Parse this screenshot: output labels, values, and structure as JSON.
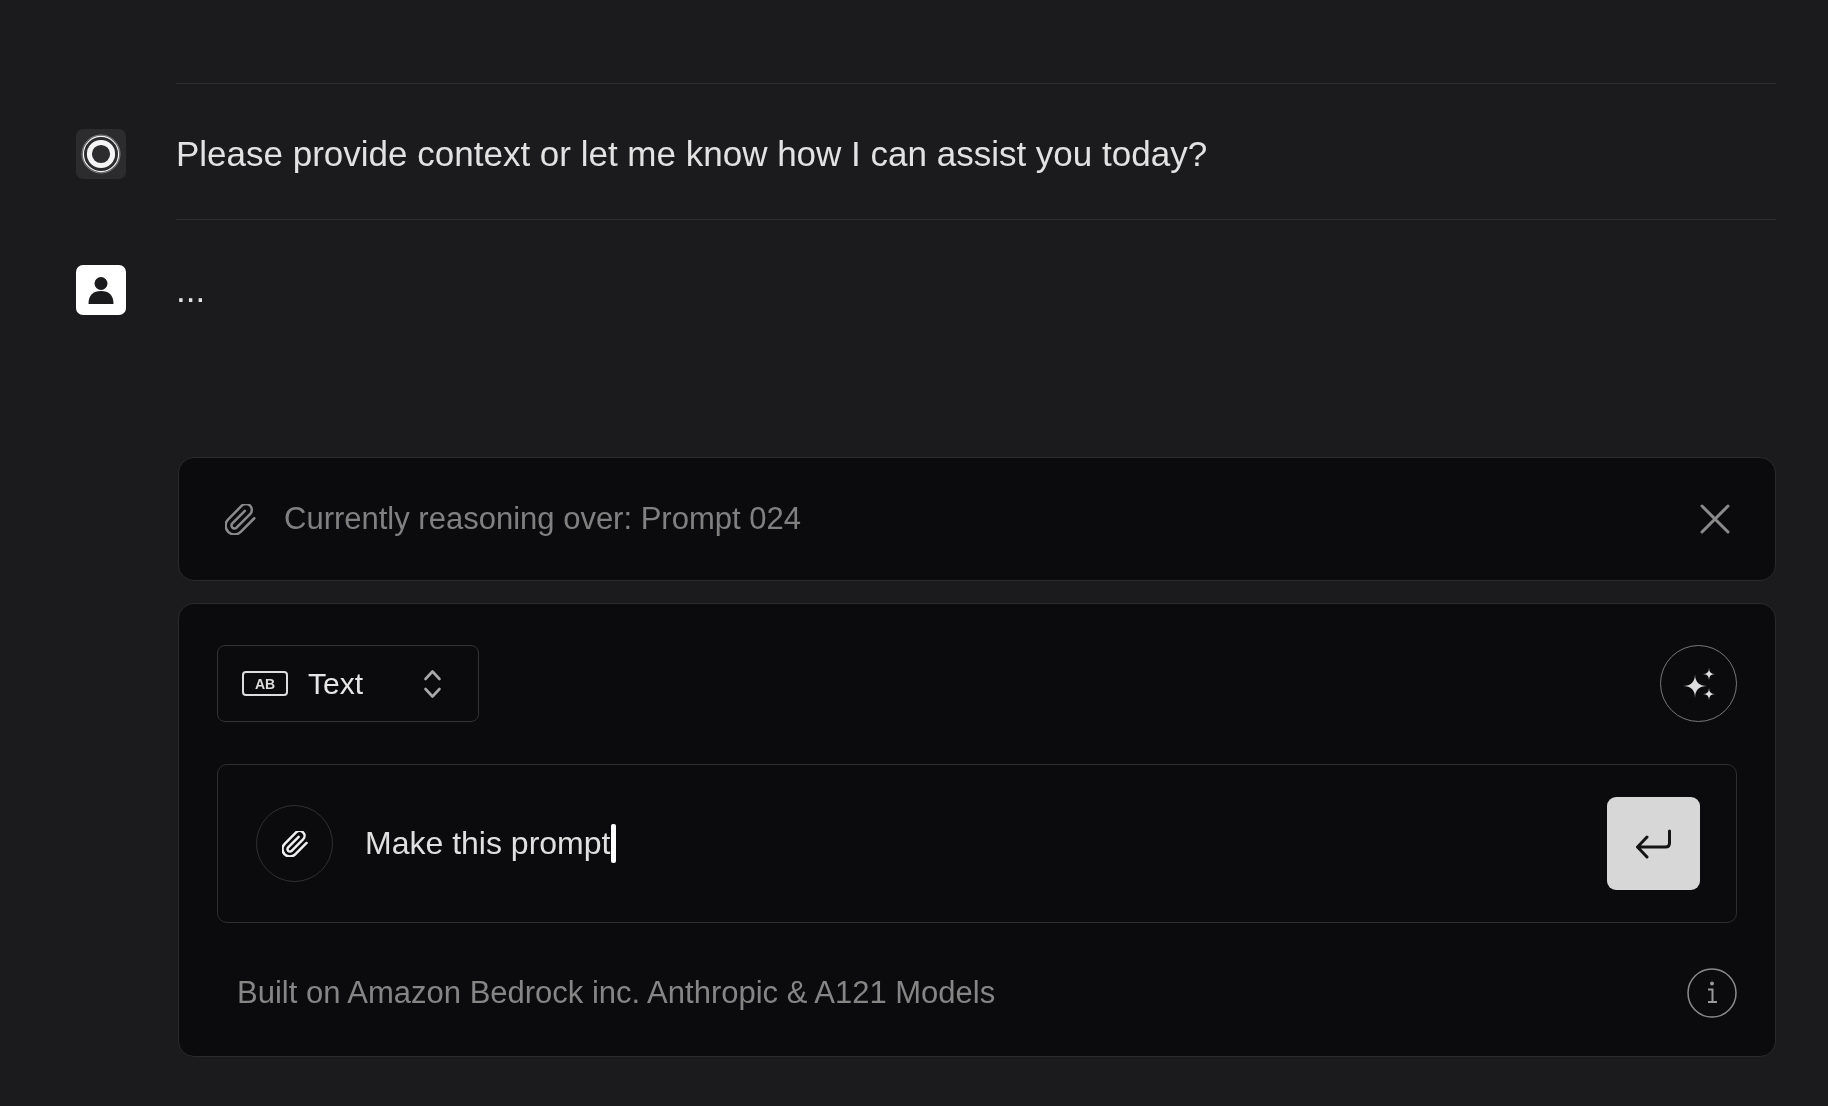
{
  "messages": [
    {
      "kind": "bot",
      "text": "Please provide context or let me know how I can assist you today?"
    },
    {
      "kind": "user",
      "text": "..."
    }
  ],
  "attachment_bar": {
    "text": "Currently reasoning over: Prompt 024"
  },
  "composer": {
    "mode_select": {
      "icon_text": "AB",
      "label": "Text"
    },
    "input": {
      "value": "Make this prompt",
      "focused": true
    },
    "footer": "Built on Amazon Bedrock inc. Anthropic & A121 Models"
  }
}
